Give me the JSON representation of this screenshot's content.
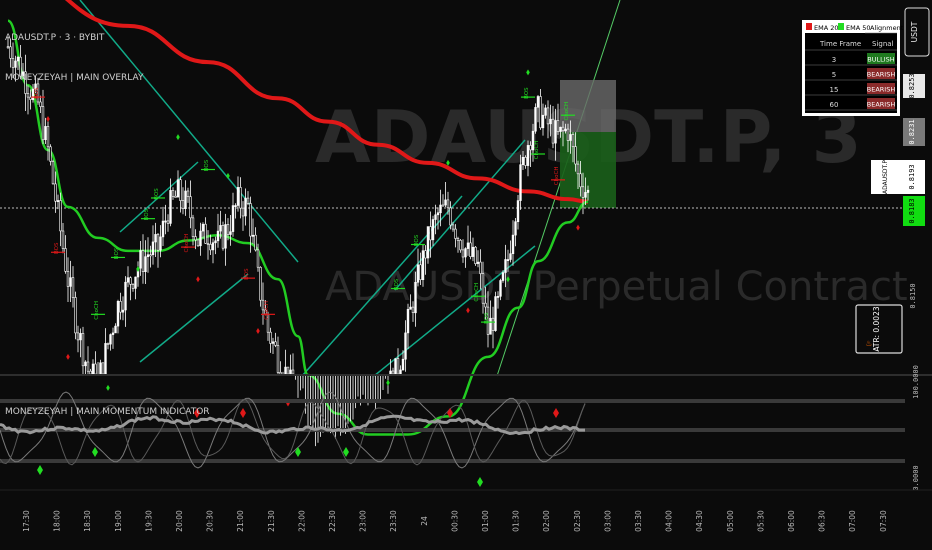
{
  "window": {
    "symbol_header": "ADAUSDT.P · 3 · BYBIT",
    "overlay_name": "MONEYZEYAH | MAIN OVERLAY",
    "momentum_name": "MONEYZEYAH | MAIN MOMENTUM INDICATOR",
    "watermark_symbol": "ADAUSDT.P, 3",
    "watermark_desc": "ADAUSDT Perpetual Contract",
    "currency_button": "USDT"
  },
  "price_axis": {
    "labels": {
      "p8253": "0.8253",
      "p8231": "0.8231",
      "p8193": "0.8193",
      "p8150": "0.8150"
    },
    "symbol_tag": "ADAUSDT.P",
    "last_price": "0.8193",
    "ema_price": "0.8183"
  },
  "atr_box": {
    "text": "ATR: 0.0023",
    "icon": "flame-icon"
  },
  "momentum_axis": {
    "top": "100.0000",
    "bottom": "0.0000"
  },
  "time_axis": {
    "labels": [
      "17:30",
      "18:00",
      "18:30",
      "19:00",
      "19:30",
      "20:00",
      "20:30",
      "21:00",
      "21:30",
      "22:00",
      "22:30",
      "23:00",
      "23:30",
      "24",
      "00:30",
      "01:00",
      "01:30",
      "02:00",
      "02:30",
      "03:00",
      "03:30",
      "04:00",
      "04:30",
      "05:00",
      "05:30",
      "06:00",
      "06:30",
      "07:00",
      "07:30"
    ]
  },
  "alignment_table": {
    "legend": [
      "EMA 200",
      "EMA 50",
      "Alignment"
    ],
    "headers": [
      "Time Frame",
      "Signal"
    ],
    "rows": [
      {
        "tf": "3",
        "signal": "BULLISH"
      },
      {
        "tf": "5",
        "signal": "BEARISH"
      },
      {
        "tf": "15",
        "signal": "BEARISH"
      },
      {
        "tf": "60",
        "signal": "BEARISH"
      }
    ]
  },
  "colors": {
    "bull": "#22dd22",
    "bear": "#e01818",
    "candle": "#ffffff",
    "ema200": "#e01818",
    "ema50": "#22cc22",
    "channel": "#11aa88"
  },
  "chart_data": {
    "type": "candlestick",
    "symbol": "ADAUSDT.P",
    "exchange": "BYBIT",
    "interval": "3",
    "yrange": [
      0.8123,
      0.8268
    ],
    "series": [
      {
        "name": "EMA 200",
        "values": [
          [
            0,
            0.8278
          ],
          [
            12,
            0.8258
          ],
          [
            20,
            0.8244
          ],
          [
            27,
            0.823
          ],
          [
            32,
            0.8221
          ],
          [
            37,
            0.8212
          ],
          [
            42,
            0.8205
          ],
          [
            47,
            0.8199
          ],
          [
            52,
            0.8194
          ],
          [
            56,
            0.8191
          ],
          [
            58,
            0.819
          ]
        ]
      },
      {
        "name": "EMA 50",
        "values": [
          [
            0,
            0.826
          ],
          [
            2,
            0.8235
          ],
          [
            4,
            0.821
          ],
          [
            6,
            0.8188
          ],
          [
            9,
            0.8176
          ],
          [
            12,
            0.8171
          ],
          [
            15,
            0.8171
          ],
          [
            18,
            0.8175
          ],
          [
            21,
            0.8177
          ],
          [
            24,
            0.8174
          ],
          [
            27,
            0.816
          ],
          [
            29,
            0.8138
          ],
          [
            30,
            0.8123
          ],
          [
            33,
            0.8108
          ],
          [
            36,
            0.81
          ],
          [
            40,
            0.81
          ],
          [
            44,
            0.8107
          ],
          [
            48,
            0.813
          ],
          [
            51,
            0.8149
          ],
          [
            53,
            0.8167
          ],
          [
            56,
            0.8182
          ],
          [
            58,
            0.819
          ]
        ]
      }
    ],
    "close_path": [
      [
        0,
        0.825
      ],
      [
        1,
        0.8244
      ],
      [
        2,
        0.8235
      ],
      [
        3,
        0.8228
      ],
      [
        4,
        0.821
      ],
      [
        5,
        0.8185
      ],
      [
        6,
        0.816
      ],
      [
        7,
        0.814
      ],
      [
        8,
        0.8125
      ],
      [
        9,
        0.812
      ],
      [
        10,
        0.8135
      ],
      [
        11,
        0.815
      ],
      [
        12,
        0.8158
      ],
      [
        13,
        0.8165
      ],
      [
        14,
        0.817
      ],
      [
        15,
        0.8172
      ],
      [
        16,
        0.8187
      ],
      [
        17,
        0.8193
      ],
      [
        18,
        0.8188
      ],
      [
        19,
        0.8175
      ],
      [
        20,
        0.8178
      ],
      [
        21,
        0.8174
      ],
      [
        22,
        0.818
      ],
      [
        23,
        0.819
      ],
      [
        24,
        0.8188
      ],
      [
        25,
        0.816
      ],
      [
        26,
        0.814
      ],
      [
        27,
        0.813
      ],
      [
        28,
        0.8122
      ],
      [
        29,
        0.811
      ],
      [
        30,
        0.81
      ],
      [
        33,
        0.8095
      ],
      [
        37,
        0.8112
      ],
      [
        39,
        0.8125
      ],
      [
        40,
        0.8143
      ],
      [
        41,
        0.816
      ],
      [
        42,
        0.8175
      ],
      [
        43,
        0.8185
      ],
      [
        44,
        0.8188
      ],
      [
        45,
        0.8177
      ],
      [
        46,
        0.817
      ],
      [
        47,
        0.8165
      ],
      [
        48,
        0.814
      ],
      [
        49,
        0.815
      ],
      [
        50,
        0.8168
      ],
      [
        51,
        0.8195
      ],
      [
        52,
        0.8213
      ],
      [
        53,
        0.8225
      ],
      [
        54,
        0.822
      ],
      [
        55,
        0.8215
      ],
      [
        56,
        0.8218
      ],
      [
        57,
        0.82
      ],
      [
        58,
        0.8193
      ]
    ],
    "signal_tags": [
      "BOS",
      "ChoCH"
    ],
    "momentum_range": [
      0,
      100
    ]
  }
}
